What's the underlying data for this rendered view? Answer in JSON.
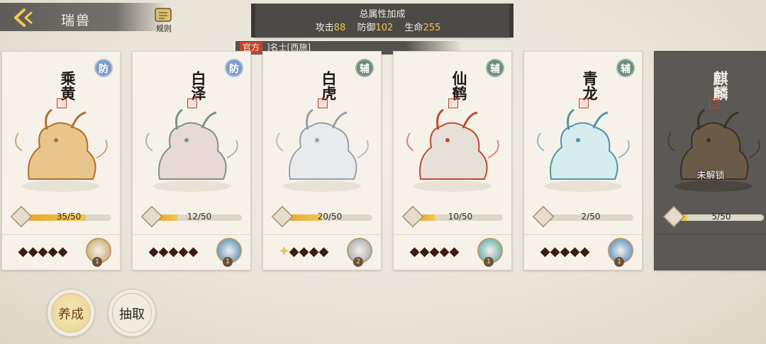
{
  "header": {
    "title": "瑞兽",
    "rules_label": "规则"
  },
  "bonus": {
    "title": "总属性加成",
    "attack_label": "攻击",
    "attack_value": "88",
    "defense_label": "防御",
    "defense_value": "102",
    "hp_label": "生命",
    "hp_value": "255"
  },
  "faction": {
    "tag": "官方",
    "text": "]名士[西施]"
  },
  "cards": [
    {
      "name": "乘黄",
      "role": "防",
      "role_type": "defense",
      "progress_text": "35/50",
      "progress": 0.7,
      "stars_gold": 0,
      "skill_level": "1",
      "locked": false
    },
    {
      "name": "白泽",
      "role": "防",
      "role_type": "defense",
      "progress_text": "12/50",
      "progress": 0.24,
      "stars_gold": 0,
      "skill_level": "1",
      "locked": false
    },
    {
      "name": "白虎",
      "role": "辅",
      "role_type": "support",
      "progress_text": "20/50",
      "progress": 0.4,
      "stars_gold": 1,
      "skill_level": "2",
      "locked": false
    },
    {
      "name": "仙鹤",
      "role": "辅",
      "role_type": "support",
      "progress_text": "10/50",
      "progress": 0.2,
      "stars_gold": 0,
      "skill_level": "1",
      "locked": false
    },
    {
      "name": "青龙",
      "role": "辅",
      "role_type": "support",
      "progress_text": "2/50",
      "progress": 0.04,
      "stars_gold": 0,
      "skill_level": "1",
      "locked": false
    },
    {
      "name": "麒麟",
      "role": "",
      "role_type": "",
      "progress_text": "5/50",
      "progress": 0.1,
      "stars_gold": 0,
      "skill_level": "",
      "locked": true,
      "locked_label": "未解锁"
    }
  ],
  "buttons": {
    "cultivate": "养成",
    "draw": "抽取"
  },
  "colors": {
    "accent_red": "#c0452d",
    "progress_gold": "#f0c653",
    "defense_blue": "#7e9cc4",
    "support_green": "#6c8b7d"
  },
  "icons": {
    "back": "chevron-left-icon",
    "rules": "scroll-icon"
  }
}
